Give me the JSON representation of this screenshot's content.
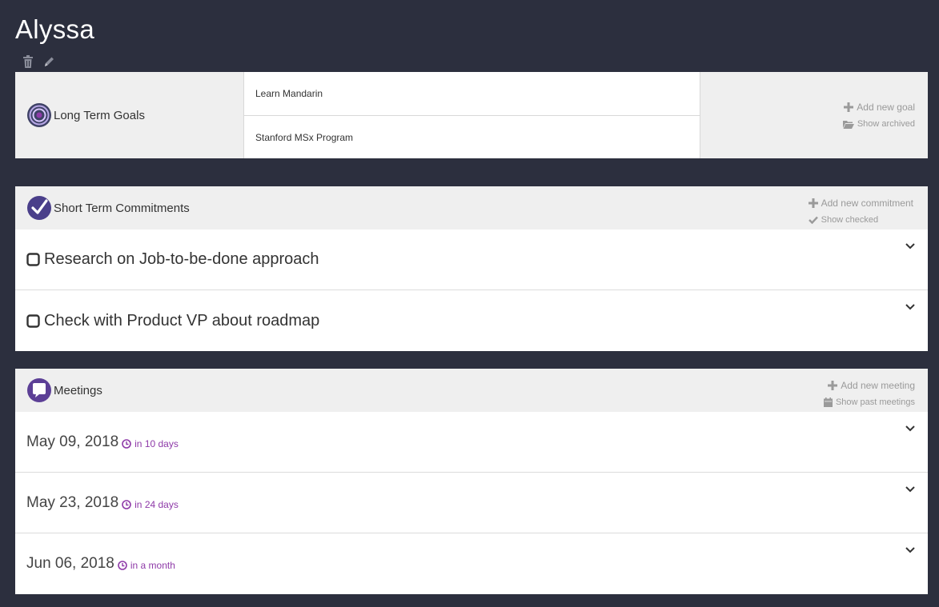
{
  "title": "Alyssa",
  "title_actions": {
    "delete_icon": "trash-icon",
    "edit_icon": "pencil-icon"
  },
  "goals": {
    "title": "Long Term Goals",
    "icon": "target-icon",
    "items": [
      {
        "label": "Learn Mandarin"
      },
      {
        "label": "Stanford MSx Program"
      }
    ],
    "add_label": "Add new goal",
    "archived_label": "Show archived"
  },
  "commitments": {
    "title": "Short Term Commitments",
    "icon": "checkmark-badge-icon",
    "add_label": "Add new commitment",
    "checked_label": "Show checked",
    "items": [
      {
        "label": "Research on Job-to-be-done approach"
      },
      {
        "label": "Check with Product VP about roadmap"
      }
    ]
  },
  "meetings": {
    "title": "Meetings",
    "icon": "speech-bubble-icon",
    "add_label": "Add new meeting",
    "past_label": "Show past meetings",
    "items": [
      {
        "date": "May 09, 2018",
        "relative": "in 10 days"
      },
      {
        "date": "May 23, 2018",
        "relative": "in 24 days"
      },
      {
        "date": "Jun 06, 2018",
        "relative": "in a month"
      }
    ]
  },
  "colors": {
    "background": "#2c2f3e",
    "card_header": "#efefef",
    "accent_purple": "#8e3aa8",
    "muted_text": "#9a9a9a"
  }
}
